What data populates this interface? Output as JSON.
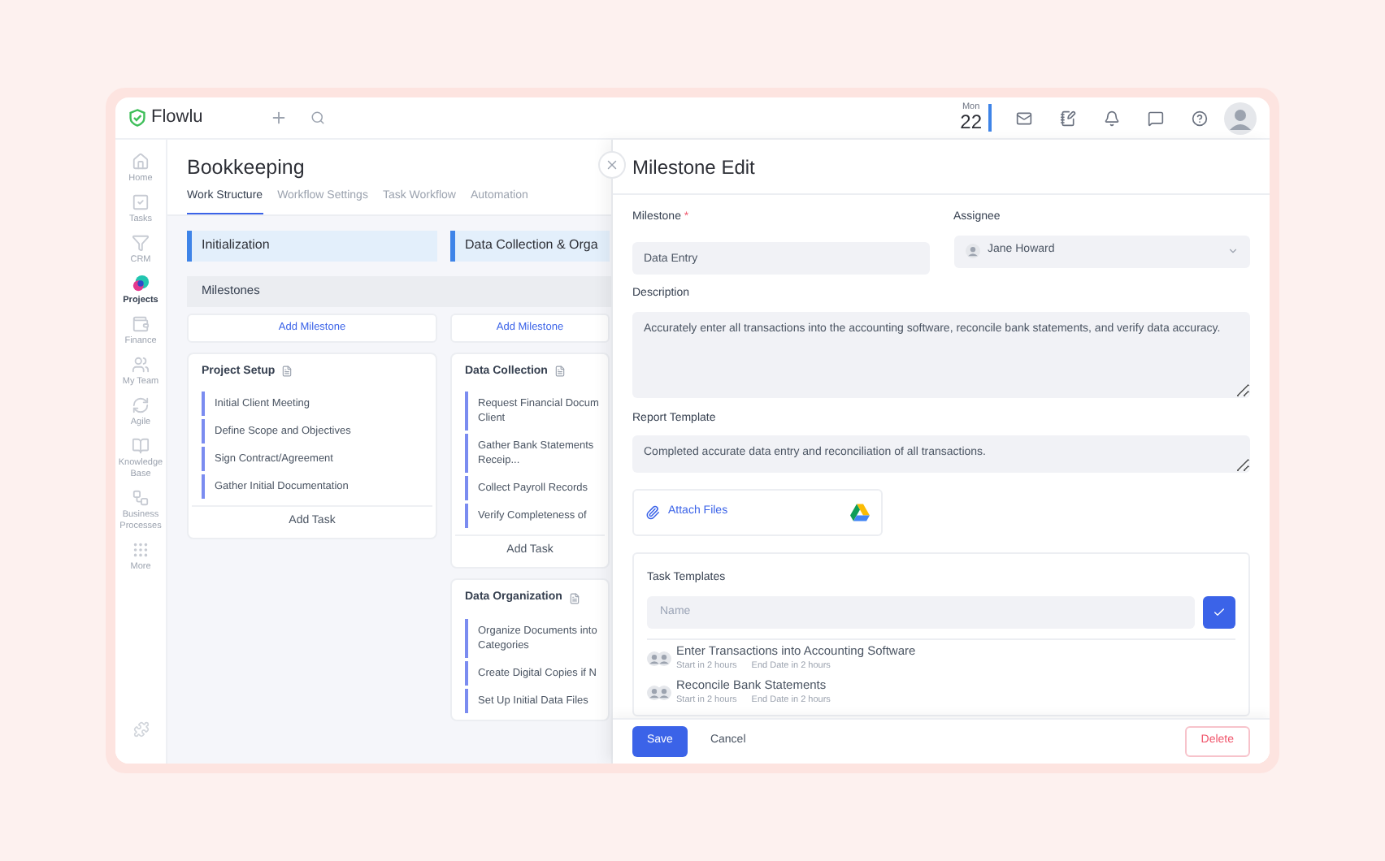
{
  "topbar": {
    "logo": "Flowlu",
    "weekday": "Mon",
    "day": "22"
  },
  "sidebar": {
    "items": [
      {
        "label": "Home",
        "selected": false
      },
      {
        "label": "Tasks",
        "selected": false
      },
      {
        "label": "CRM",
        "selected": false
      },
      {
        "label": "Projects",
        "selected": true
      },
      {
        "label": "Finance",
        "selected": false
      },
      {
        "label": "My Team",
        "selected": false
      },
      {
        "label": "Agile",
        "selected": false
      },
      {
        "label": "Knowledge Base",
        "selected": false
      },
      {
        "label": "Business Processes",
        "selected": false
      },
      {
        "label": "More",
        "selected": false
      }
    ]
  },
  "board": {
    "title": "Bookkeeping",
    "tabs": [
      {
        "label": "Work Structure",
        "selected": true
      },
      {
        "label": "Workflow Settings",
        "selected": false
      },
      {
        "label": "Task Workflow",
        "selected": false
      },
      {
        "label": "Automation",
        "selected": false
      }
    ],
    "milestones_label": "Milestones",
    "columns": [
      {
        "stage": "Initialization",
        "add_milestone": "Add Milestone",
        "milestones": [
          {
            "title": "Project Setup",
            "tasks": [
              "Initial Client Meeting",
              "Define Scope and Objectives",
              "Sign Contract/Agreement",
              "Gather Initial Documentation"
            ],
            "add_task": "Add Task"
          }
        ]
      },
      {
        "stage": "Data Collection & Orga",
        "add_milestone": "Add Milestone",
        "milestones": [
          {
            "title": "Data Collection",
            "tasks": [
              "Request Financial Docum\nClient",
              "Gather Bank Statements\nReceip...",
              "Collect Payroll Records",
              "Verify Completeness of"
            ],
            "add_task": "Add Task"
          },
          {
            "title": "Data Organization",
            "tasks": [
              "Organize Documents into\nCategories",
              "Create Digital Copies if N",
              "Set Up Initial Data Files"
            ]
          }
        ]
      }
    ]
  },
  "panel": {
    "title": "Milestone Edit",
    "milestone": {
      "label": "Milestone",
      "required_mark": "*",
      "value": "Data Entry"
    },
    "assignee": {
      "label": "Assignee",
      "value": "Jane Howard"
    },
    "description": {
      "label": "Description",
      "value": "Accurately enter all transactions into the accounting software, reconcile bank statements, and verify data accuracy."
    },
    "report": {
      "label": "Report Template",
      "value": "Completed accurate data entry and reconciliation of all transactions."
    },
    "attach": "Attach Files",
    "task_templates": {
      "label": "Task Templates",
      "placeholder": "Name",
      "items": [
        {
          "title": "Enter Transactions into Accounting Software",
          "start": "Start in 2 hours",
          "end": "End Date in 2 hours"
        },
        {
          "title": "Reconcile Bank Statements",
          "start": "Start in 2 hours",
          "end": "End Date in 2 hours"
        }
      ]
    },
    "buttons": {
      "save": "Save",
      "cancel": "Cancel",
      "delete": "Delete"
    }
  }
}
